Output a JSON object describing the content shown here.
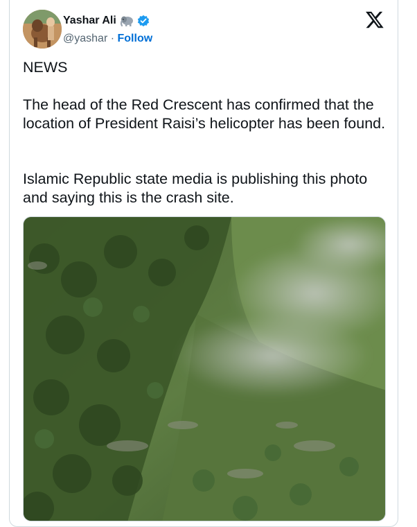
{
  "tweet": {
    "author_name": "Yashar Ali",
    "author_handle": "@yashar",
    "separator": "·",
    "follow_label": "Follow",
    "paragraphs": [
      "NEWS",
      "The head of the Red Crescent has confirmed that the location of President Raisi’s helicopter has been found.",
      "Islamic Republic state media is publishing this photo and saying this is the crash site."
    ]
  },
  "icons": {
    "author_badge": "elephant-emoji-icon",
    "verified": "verified-badge-icon",
    "platform": "x-logo-icon"
  },
  "colors": {
    "follow": "#006fd6",
    "verified": "#1d9bf0",
    "handle": "#536471",
    "border": "#cfd9de"
  }
}
